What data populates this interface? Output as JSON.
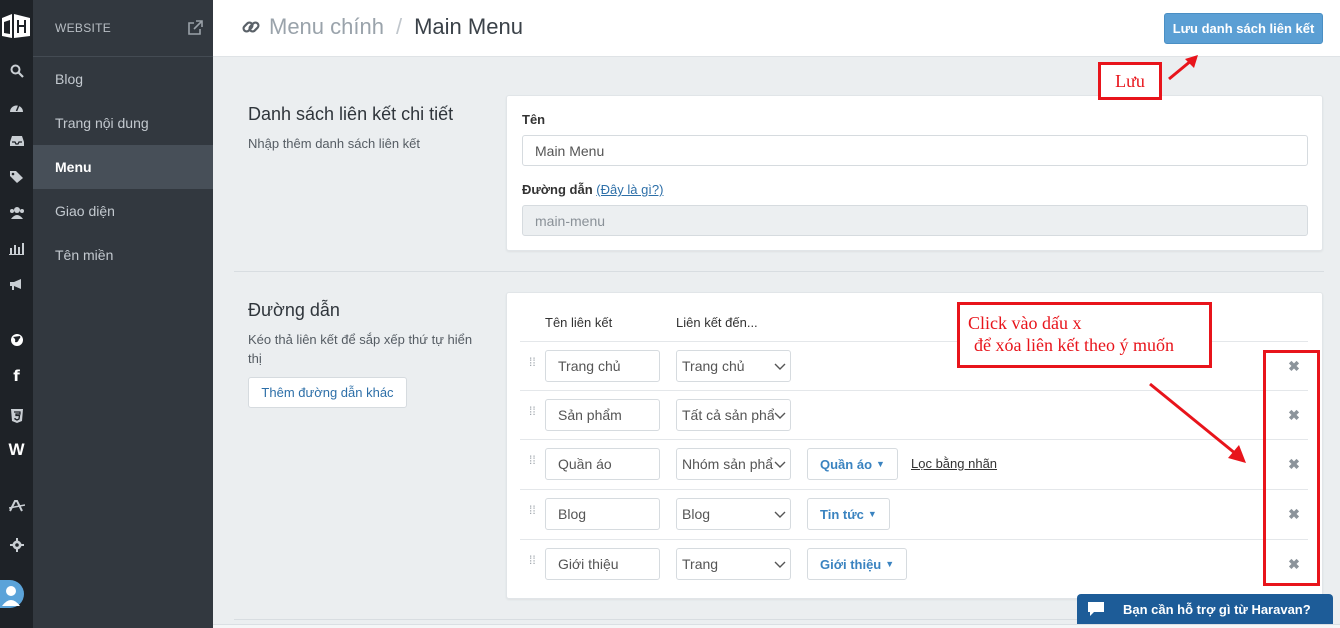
{
  "header": {
    "breadcrumb_parent": "Menu chính",
    "breadcrumb_separator": "/",
    "breadcrumb_current": "Main Menu",
    "save_button": "Lưu danh sách liên kết"
  },
  "sidebar": {
    "section_label": "WEBSITE",
    "items": [
      {
        "label": "Blog",
        "active": false
      },
      {
        "label": "Trang nội dung",
        "active": false
      },
      {
        "label": "Menu",
        "active": true
      },
      {
        "label": "Giao diện",
        "active": false
      },
      {
        "label": "Tên miền",
        "active": false
      }
    ]
  },
  "rail_icons": [
    "search-icon",
    "dashboard-icon",
    "inbox-icon",
    "tag-icon",
    "users-icon",
    "bar-chart-icon",
    "megaphone-icon",
    "globe-icon",
    "facebook-icon",
    "html5-icon",
    "wordpress-icon",
    "app-icon",
    "gear-icon",
    "avatar"
  ],
  "details": {
    "title": "Danh sách liên kết chi tiết",
    "description": "Nhập thêm danh sách liên kết",
    "name_label": "Tên",
    "name_value": "Main Menu",
    "path_label": "Đường dẫn",
    "path_help": "(Đây là gì?)",
    "path_value": "main-menu"
  },
  "links": {
    "title": "Đường dẫn",
    "description": "Kéo thả liên kết để sắp xếp thứ tự hiển thị",
    "add_button": "Thêm đường dẫn khác",
    "col_name": "Tên liên kết",
    "col_target": "Liên kết đến...",
    "filter_label": "Lọc bằng nhãn",
    "rows": [
      {
        "name": "Trang chủ",
        "target": "Trang chủ",
        "detail": ""
      },
      {
        "name": "Sản phẩm",
        "target": "Tất cả sản phẩm",
        "detail": ""
      },
      {
        "name": "Quần áo",
        "target": "Nhóm sản phẩm",
        "detail": "Quần áo"
      },
      {
        "name": "Blog",
        "target": "Blog",
        "detail": "Tin tức"
      },
      {
        "name": "Giới thiệu",
        "target": "Trang",
        "detail": "Giới thiệu"
      }
    ]
  },
  "annotations": {
    "save_note": "Lưu",
    "delete_note_line1": "Click vào dấu x",
    "delete_note_line2": "để xóa liên kết theo ý muốn",
    "color": "#e8141b"
  },
  "help_widget": {
    "label": "Bạn cần hỗ trợ gì từ Haravan?"
  },
  "colors": {
    "accent": "#5b9fd4",
    "sidebar_bg": "#32383f",
    "rail_bg": "#1e2227",
    "link": "#3a83c0"
  }
}
